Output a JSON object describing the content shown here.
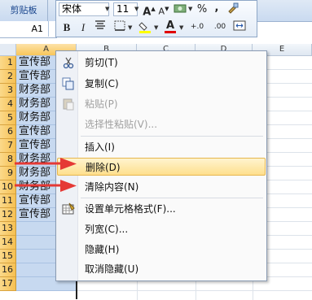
{
  "ribbon": {
    "clipboard_label": "剪贴板"
  },
  "namebox": {
    "value": "A1"
  },
  "toolbar": {
    "font_name": "宋体",
    "font_size": "11",
    "grow_font": "A˄",
    "shrink_font": "A˅",
    "percent": "%",
    "comma": ",",
    "bold": "B",
    "italic": "I",
    "increase_decimal": ".0→.00",
    "decrease_decimal": ".00→.0"
  },
  "columns": [
    "A",
    "B",
    "C",
    "D",
    "E"
  ],
  "rows": [
    "1",
    "2",
    "3",
    "4",
    "5",
    "6",
    "7",
    "8",
    "9",
    "10",
    "11",
    "12",
    "13",
    "14",
    "15",
    "16",
    "17"
  ],
  "cells": [
    "宣传部",
    "宣传部",
    "财务部",
    "财务部",
    "财务部",
    "宣传部",
    "宣传部",
    "财务部",
    "财务部",
    "财务部",
    "宣传部",
    "宣传部",
    "",
    "",
    "",
    "",
    ""
  ],
  "menu": {
    "items": [
      {
        "label": "剪切(T)",
        "icon": "scissors-icon",
        "disabled": false
      },
      {
        "label": "复制(C)",
        "icon": "copy-icon",
        "disabled": false
      },
      {
        "label": "粘贴(P)",
        "icon": "paste-icon",
        "disabled": true
      },
      {
        "label": "选择性粘贴(V)...",
        "icon": "",
        "disabled": true
      },
      {
        "label": "插入(I)",
        "icon": "",
        "disabled": false
      },
      {
        "label": "删除(D)",
        "icon": "",
        "disabled": false,
        "highlighted": true
      },
      {
        "label": "清除内容(N)",
        "icon": "",
        "disabled": false
      },
      {
        "label": "设置单元格格式(F)...",
        "icon": "format-cells-icon",
        "disabled": false
      },
      {
        "label": "列宽(C)...",
        "icon": "",
        "disabled": false
      },
      {
        "label": "隐藏(H)",
        "icon": "",
        "disabled": false
      },
      {
        "label": "取消隐藏(U)",
        "icon": "",
        "disabled": false
      }
    ]
  },
  "colors": {
    "arrow": "#e53935",
    "highlight": "#fedf8d",
    "selection": "#c7d9f0",
    "rowheader_selected": "#f6c052"
  }
}
